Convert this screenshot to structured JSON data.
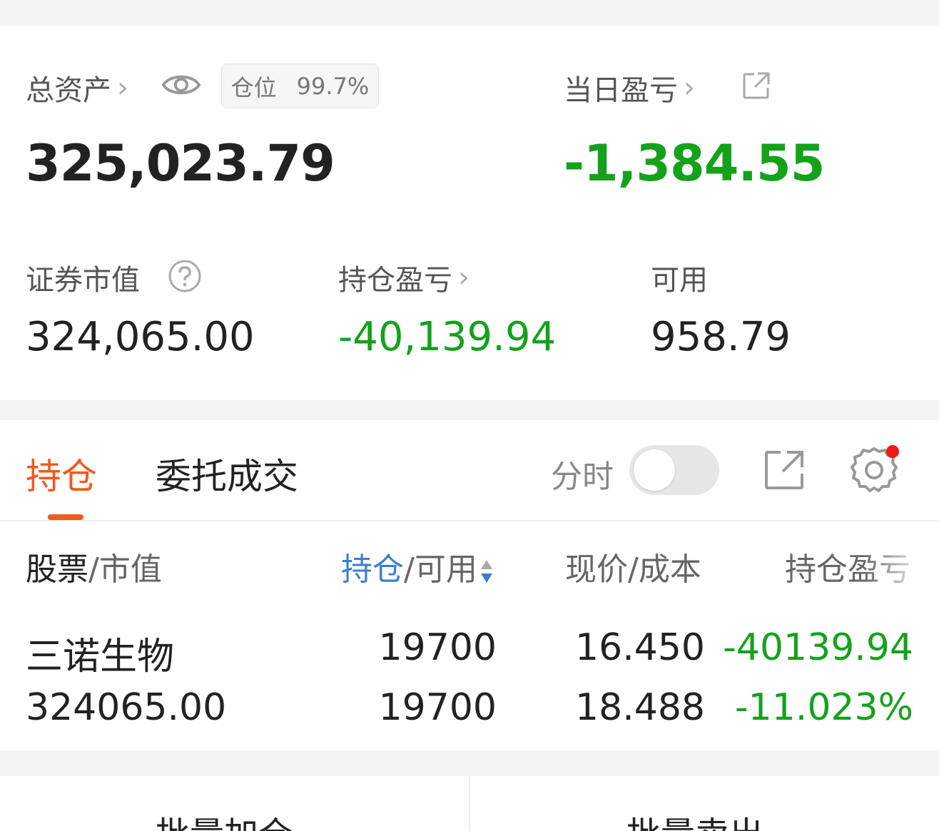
{
  "summary": {
    "total_assets_label": "总资产",
    "position_label": "仓位",
    "position_value": "99.7%",
    "total_assets_value": "325,023.79",
    "daily_pnl_label": "当日盈亏",
    "daily_pnl_value": "-1,384.55",
    "market_value_label": "证券市值",
    "market_value": "324,065.00",
    "holding_pnl_label": "持仓盈亏",
    "holding_pnl_value": "-40,139.94",
    "available_label": "可用",
    "available_value": "958.79"
  },
  "tabs": {
    "holdings": "持仓",
    "orders": "委托成交"
  },
  "toolbar": {
    "intraday_label": "分时"
  },
  "table": {
    "headers": {
      "stock": "股票",
      "stock_sub": "/市值",
      "position": "持仓",
      "position_sub": "/可用",
      "price": "现价/成本",
      "pnl": "持仓盈亏"
    },
    "rows": [
      {
        "name": "三诺生物",
        "market_value": "324065.00",
        "position": "19700",
        "available": "19700",
        "price": "16.450",
        "cost": "18.488",
        "pnl": "-40139.94",
        "pnl_pct": "-11.023%"
      }
    ]
  },
  "actions": {
    "batch_add": "批量加仓",
    "batch_sell": "批量卖出"
  },
  "colors": {
    "accent": "#f15a1a",
    "loss_green": "#14a21b",
    "sort_blue": "#3a7fd1",
    "notification_red": "#f01818"
  }
}
